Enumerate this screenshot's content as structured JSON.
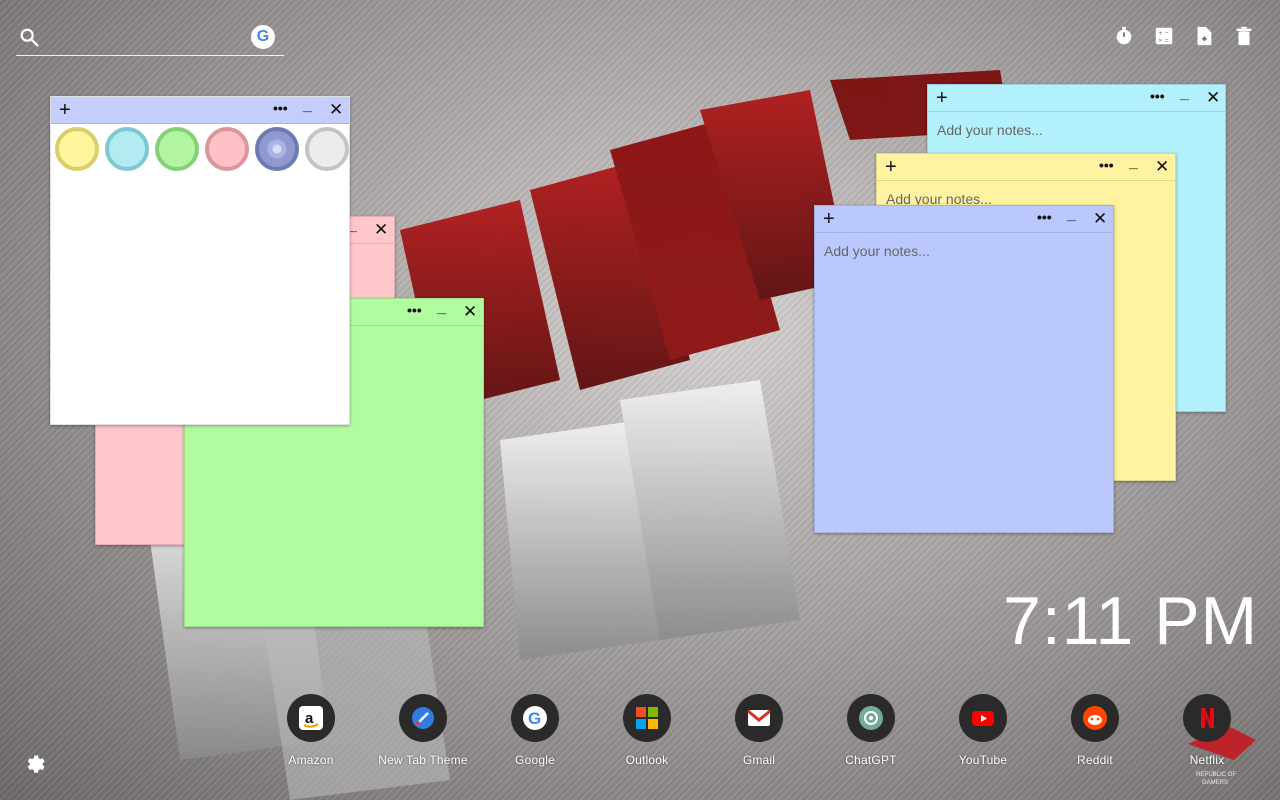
{
  "search": {
    "placeholder": "",
    "value": ""
  },
  "toolbar": {
    "timer_icon": "timer-icon",
    "calculator_icon": "calculator-icon",
    "new_note_icon": "new-note-icon",
    "trash_icon": "trash-icon"
  },
  "notes": [
    {
      "id": "white",
      "color": "#ffffff",
      "add_label": "+",
      "more_label": "•••",
      "min_label": "_",
      "close_label": "✕",
      "placeholder": "",
      "swatches": [
        {
          "name": "yellow",
          "fill": "#fff59d",
          "ring": "#d9cf6a"
        },
        {
          "name": "cyan",
          "fill": "#b2ebf2",
          "ring": "#7fc7d1"
        },
        {
          "name": "green",
          "fill": "#b2f5a0",
          "ring": "#86d074"
        },
        {
          "name": "pink",
          "fill": "#ffc1c6",
          "ring": "#d9979c"
        },
        {
          "name": "blue",
          "fill": "#8f9bd0",
          "ring": "#6f7ab0"
        },
        {
          "name": "grey",
          "fill": "#ececec",
          "ring": "#c4c4c4"
        }
      ]
    },
    {
      "id": "pink",
      "color": "#ffc7c9",
      "more_label": "•••",
      "min_label": "_",
      "close_label": "✕",
      "placeholder": ""
    },
    {
      "id": "green",
      "color": "#b2fca0",
      "more_label": "•••",
      "min_label": "_",
      "close_label": "✕",
      "placeholder": ""
    },
    {
      "id": "cyan",
      "color": "#b2f0fb",
      "add_label": "+",
      "more_label": "•••",
      "min_label": "_",
      "close_label": "✕",
      "placeholder": "Add your notes..."
    },
    {
      "id": "yellow",
      "color": "#fff3a1",
      "add_label": "+",
      "more_label": "•••",
      "min_label": "_",
      "close_label": "✕",
      "placeholder": "Add your notes..."
    },
    {
      "id": "blue",
      "color": "#bac8fd",
      "add_label": "+",
      "more_label": "•••",
      "min_label": "_",
      "close_label": "✕",
      "placeholder": "Add your notes..."
    }
  ],
  "clock": {
    "time": "7:11 PM"
  },
  "dock": [
    {
      "label": "Amazon",
      "icon": "amazon-icon"
    },
    {
      "label": "New Tab Theme",
      "icon": "new-tab-theme-icon"
    },
    {
      "label": "Google",
      "icon": "google-icon"
    },
    {
      "label": "Outlook",
      "icon": "outlook-icon"
    },
    {
      "label": "Gmail",
      "icon": "gmail-icon"
    },
    {
      "label": "ChatGPT",
      "icon": "chatgpt-icon"
    },
    {
      "label": "YouTube",
      "icon": "youtube-icon"
    },
    {
      "label": "Reddit",
      "icon": "reddit-icon"
    },
    {
      "label": "Netflix",
      "icon": "netflix-icon"
    }
  ],
  "background": {
    "caption": "REPUBLIC OF GAMERS"
  },
  "settings": {
    "icon": "gear-icon"
  }
}
